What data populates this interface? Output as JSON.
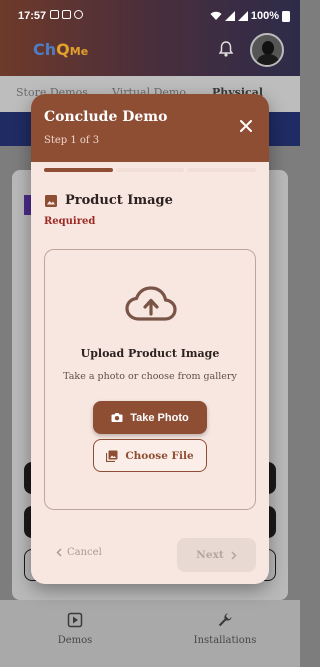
{
  "status_bar": {
    "time": "17:57",
    "battery": "100%"
  },
  "app": {
    "logo_ch": "Ch",
    "logo_q": "Q",
    "logo_me": "Me",
    "tabs": [
      {
        "label": "Store Demos"
      },
      {
        "label": "Virtual Demo"
      },
      {
        "label": "Physical Demo"
      }
    ],
    "bottom_nav": [
      {
        "label": "Demos",
        "icon": "play-box-icon"
      },
      {
        "label": "Installations",
        "icon": "wrench-icon"
      }
    ]
  },
  "modal": {
    "title": "Conclude Demo",
    "step": "Step 1 of 3",
    "progress": {
      "current_step": 1,
      "total_steps": 3
    },
    "section_title": "Product Image",
    "required_label": "Required",
    "upload": {
      "title": "Upload Product Image",
      "subtitle": "Take a photo or choose from gallery",
      "take_photo_label": "Take Photo",
      "choose_file_label": "Choose File"
    },
    "footer": {
      "cancel_label": "Cancel",
      "next_label": "Next"
    }
  },
  "colors": {
    "accent": "#8e4e34",
    "modal_bg": "#f8e7e1",
    "required": "#9b2a22",
    "disabled_text": "#b4a5a0"
  }
}
